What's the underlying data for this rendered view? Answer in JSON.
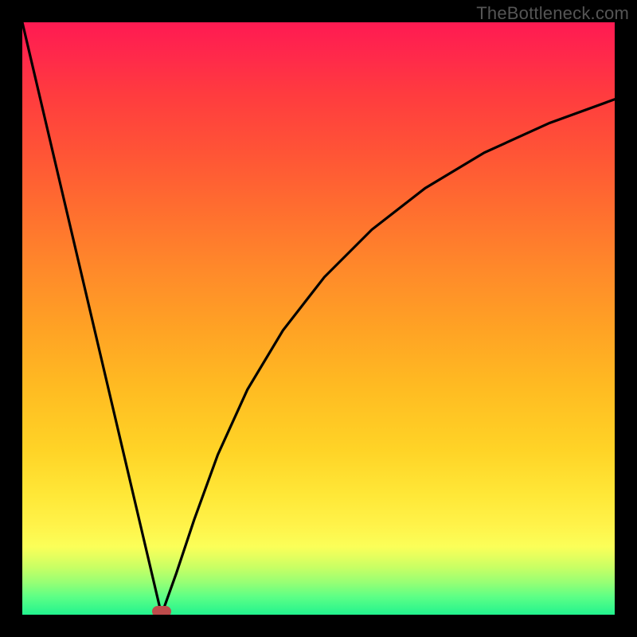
{
  "watermark": "TheBottleneck.com",
  "chart_data": {
    "type": "line",
    "title": "",
    "xlabel": "",
    "ylabel": "",
    "xlim": [
      0,
      100
    ],
    "ylim": [
      0,
      1
    ],
    "grid": false,
    "series": [
      {
        "name": "left-branch",
        "x": [
          0,
          23.5
        ],
        "values": [
          1.0,
          0.0
        ]
      },
      {
        "name": "right-branch",
        "x": [
          23.5,
          26,
          29,
          33,
          38,
          44,
          51,
          59,
          68,
          78,
          89,
          100
        ],
        "values": [
          0.0,
          0.07,
          0.16,
          0.27,
          0.38,
          0.48,
          0.57,
          0.65,
          0.72,
          0.78,
          0.83,
          0.87
        ]
      }
    ],
    "annotations": [
      {
        "name": "optimum-marker",
        "x": 23.5,
        "y": 0.005,
        "color": "#be4b4b"
      }
    ],
    "background_gradient": {
      "top": "#ff1a52",
      "mid": "#ffbc22",
      "bottom": "#22f38e"
    }
  }
}
